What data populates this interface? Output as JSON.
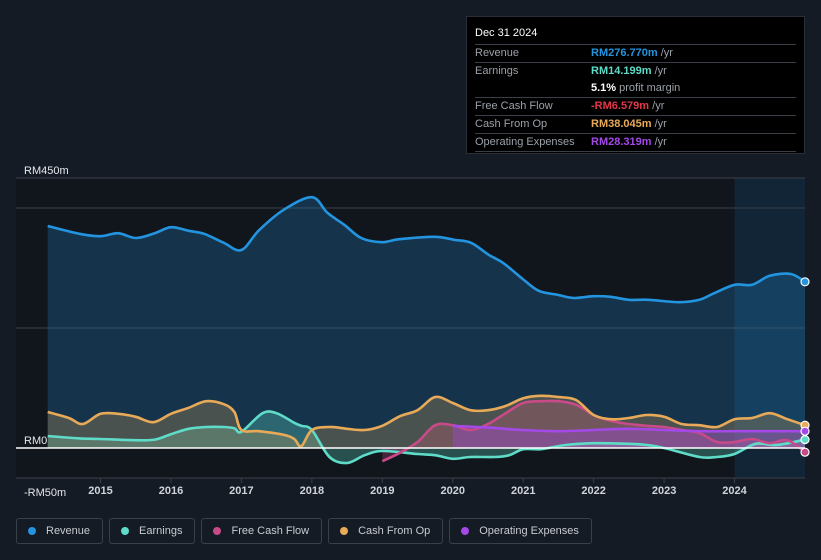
{
  "tooltip": {
    "date": "Dec 31 2024",
    "rows": [
      {
        "label": "Revenue",
        "value": "RM276.770m",
        "unit": " /yr",
        "color": "#2394df"
      },
      {
        "label": "Earnings",
        "value": "RM14.199m",
        "unit": " /yr",
        "color": "#5fdcc8"
      },
      {
        "label": "",
        "value": "5.1%",
        "unit": " profit margin",
        "color": "#ffffff"
      },
      {
        "label": "Free Cash Flow",
        "value": "-RM6.579m",
        "unit": " /yr",
        "color": "#e0384a"
      },
      {
        "label": "Cash From Op",
        "value": "RM38.045m",
        "unit": " /yr",
        "color": "#e8aa58"
      },
      {
        "label": "Operating Expenses",
        "value": "RM28.319m",
        "unit": " /yr",
        "color": "#a449e8"
      }
    ]
  },
  "legend": [
    {
      "label": "Revenue",
      "color": "#2394df"
    },
    {
      "label": "Earnings",
      "color": "#5fdcc8"
    },
    {
      "label": "Free Cash Flow",
      "color": "#c84a88"
    },
    {
      "label": "Cash From Op",
      "color": "#e8aa58"
    },
    {
      "label": "Operating Expenses",
      "color": "#a449e8"
    }
  ],
  "chart_data": {
    "type": "area",
    "title": "",
    "xlabel": "",
    "ylabel": "",
    "y_tick_labels": [
      "RM450m",
      "RM0",
      "-RM50m"
    ],
    "ylim": [
      -50,
      450
    ],
    "xlim": [
      2013.8,
      2025.0
    ],
    "x_ticks": [
      "2015",
      "2016",
      "2017",
      "2018",
      "2019",
      "2020",
      "2021",
      "2022",
      "2023",
      "2024"
    ],
    "highlight_from": 2024.0,
    "grid": true,
    "legend_position": "bottom-left",
    "series": [
      {
        "name": "Revenue",
        "color": "#2394df",
        "x": [
          2014.25,
          2014.7,
          2015.0,
          2015.25,
          2015.5,
          2015.77,
          2016.0,
          2016.25,
          2016.47,
          2016.75,
          2017.0,
          2017.25,
          2017.6,
          2018.0,
          2018.22,
          2018.46,
          2018.7,
          2018.99,
          2019.24,
          2019.74,
          2020.02,
          2020.26,
          2020.51,
          2020.72,
          2021.01,
          2021.22,
          2021.5,
          2021.72,
          2022.0,
          2022.24,
          2022.5,
          2022.78,
          2023.21,
          2023.5,
          2023.71,
          2024.0,
          2024.25,
          2024.5,
          2024.8,
          2025.0
        ],
        "values": [
          370,
          357,
          353,
          358,
          350,
          358,
          368,
          362,
          357,
          342,
          330,
          363,
          397,
          418,
          392,
          372,
          350,
          343,
          348,
          352,
          347,
          342,
          322,
          308,
          280,
          262,
          255,
          250,
          253,
          252,
          247,
          247,
          243,
          247,
          258,
          272,
          272,
          287,
          290,
          277
        ]
      },
      {
        "name": "Earnings",
        "color": "#5fdcc8",
        "x": [
          2014.25,
          2014.7,
          2015.0,
          2015.5,
          2015.77,
          2016.0,
          2016.25,
          2016.5,
          2016.75,
          2016.9,
          2017.0,
          2017.3,
          2017.5,
          2017.75,
          2017.85,
          2018.0,
          2018.25,
          2018.5,
          2018.75,
          2019.0,
          2019.5,
          2019.75,
          2020.0,
          2020.25,
          2020.6,
          2020.8,
          2021.0,
          2021.25,
          2021.6,
          2022.0,
          2022.5,
          2022.75,
          2023.0,
          2023.5,
          2023.75,
          2024.0,
          2024.3,
          2024.6,
          2025.0
        ],
        "values": [
          20,
          16,
          15,
          13,
          14,
          23,
          32,
          35,
          35,
          33,
          27,
          58,
          58,
          42,
          37,
          30,
          -15,
          -25,
          -12,
          -5,
          -10,
          -12,
          -18,
          -15,
          -15,
          -12,
          -2,
          -2,
          5,
          8,
          7,
          5,
          0,
          -15,
          -15,
          -10,
          7,
          5,
          14
        ]
      },
      {
        "name": "Free Cash Flow",
        "color": "#c84a88",
        "x": [
          2019.0,
          2019.25,
          2019.5,
          2019.75,
          2020.0,
          2020.25,
          2020.5,
          2020.75,
          2021.0,
          2021.25,
          2021.5,
          2021.75,
          2022.0,
          2022.25,
          2022.5,
          2022.75,
          2023.0,
          2023.25,
          2023.5,
          2023.75,
          2024.0,
          2024.25,
          2024.5,
          2024.75,
          2025.0
        ],
        "values": [
          -22,
          -8,
          10,
          38,
          38,
          30,
          40,
          58,
          75,
          78,
          78,
          72,
          55,
          45,
          40,
          37,
          35,
          30,
          25,
          10,
          10,
          15,
          8,
          13,
          -7
        ]
      },
      {
        "name": "Cash From Op",
        "color": "#e8aa58",
        "x": [
          2014.25,
          2014.55,
          2014.75,
          2015.0,
          2015.25,
          2015.5,
          2015.75,
          2016.0,
          2016.25,
          2016.5,
          2016.75,
          2016.9,
          2017.0,
          2017.25,
          2017.6,
          2017.75,
          2017.85,
          2018.0,
          2018.25,
          2018.5,
          2018.75,
          2019.0,
          2019.25,
          2019.5,
          2019.75,
          2020.0,
          2020.25,
          2020.5,
          2020.75,
          2021.0,
          2021.25,
          2021.5,
          2021.75,
          2022.0,
          2022.25,
          2022.5,
          2022.75,
          2023.0,
          2023.25,
          2023.5,
          2023.75,
          2024.0,
          2024.25,
          2024.5,
          2024.75,
          2025.0
        ],
        "values": [
          60,
          50,
          40,
          57,
          57,
          52,
          43,
          57,
          67,
          78,
          73,
          60,
          30,
          28,
          22,
          15,
          3,
          30,
          35,
          32,
          30,
          37,
          53,
          63,
          85,
          75,
          63,
          63,
          70,
          83,
          87,
          85,
          80,
          55,
          48,
          50,
          55,
          52,
          40,
          38,
          35,
          48,
          50,
          58,
          48,
          38
        ]
      },
      {
        "name": "Operating Expenses",
        "color": "#a449e8",
        "x": [
          2020.0,
          2020.5,
          2021.0,
          2021.5,
          2022.0,
          2022.5,
          2023.0,
          2023.5,
          2024.0,
          2024.5,
          2025.0
        ],
        "values": [
          37,
          34,
          30,
          28,
          30,
          32,
          30,
          28,
          28,
          28,
          28
        ]
      }
    ]
  }
}
